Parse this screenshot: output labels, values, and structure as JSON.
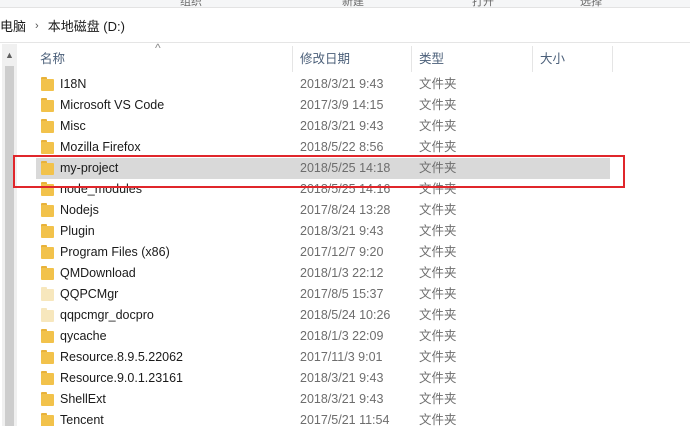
{
  "ribbon": {
    "labels": [
      "组织",
      "新建",
      "打开",
      "选择"
    ]
  },
  "address": {
    "crumbs": [
      "电脑",
      "本地磁盘 (D:)"
    ],
    "separator": "›"
  },
  "columns": {
    "name": "名称",
    "date": "修改日期",
    "type": "类型",
    "size": "大小"
  },
  "sort_indicator": "^",
  "colors": {
    "folder": "#f2c24b",
    "folder_tab": "#e8b23a",
    "folder_light": "#f7e7bd",
    "selected_row": "#d9d9d9",
    "highlight": "#e0262b"
  },
  "rows": [
    {
      "name": "I18N",
      "date": "2018/3/21 9:43",
      "type": "文件夹",
      "icon": "folder-icon",
      "selected": false
    },
    {
      "name": "Microsoft VS Code",
      "date": "2017/3/9 14:15",
      "type": "文件夹",
      "icon": "folder-icon",
      "selected": false
    },
    {
      "name": "Misc",
      "date": "2018/3/21 9:43",
      "type": "文件夹",
      "icon": "folder-icon",
      "selected": false
    },
    {
      "name": "Mozilla Firefox",
      "date": "2018/5/22 8:56",
      "type": "文件夹",
      "icon": "folder-icon",
      "selected": false
    },
    {
      "name": "my-project",
      "date": "2018/5/25 14:18",
      "type": "文件夹",
      "icon": "folder-icon",
      "selected": true
    },
    {
      "name": "node_modules",
      "date": "2018/5/25 14:16",
      "type": "文件夹",
      "icon": "folder-icon",
      "selected": false
    },
    {
      "name": "Nodejs",
      "date": "2017/8/24 13:28",
      "type": "文件夹",
      "icon": "folder-icon",
      "selected": false
    },
    {
      "name": "Plugin",
      "date": "2018/3/21 9:43",
      "type": "文件夹",
      "icon": "folder-icon",
      "selected": false
    },
    {
      "name": "Program Files (x86)",
      "date": "2017/12/7 9:20",
      "type": "文件夹",
      "icon": "folder-icon",
      "selected": false
    },
    {
      "name": "QMDownload",
      "date": "2018/1/3 22:12",
      "type": "文件夹",
      "icon": "folder-icon",
      "selected": false
    },
    {
      "name": "QQPCMgr",
      "date": "2017/8/5 15:37",
      "type": "文件夹",
      "icon": "folder-light-icon",
      "selected": false
    },
    {
      "name": "qqpcmgr_docpro",
      "date": "2018/5/24 10:26",
      "type": "文件夹",
      "icon": "folder-light-icon",
      "selected": false
    },
    {
      "name": "qycache",
      "date": "2018/1/3 22:09",
      "type": "文件夹",
      "icon": "folder-icon",
      "selected": false
    },
    {
      "name": "Resource.8.9.5.22062",
      "date": "2017/11/3 9:01",
      "type": "文件夹",
      "icon": "folder-icon",
      "selected": false
    },
    {
      "name": "Resource.9.0.1.23161",
      "date": "2018/3/21 9:43",
      "type": "文件夹",
      "icon": "folder-icon",
      "selected": false
    },
    {
      "name": "ShellExt",
      "date": "2018/3/21 9:43",
      "type": "文件夹",
      "icon": "folder-icon",
      "selected": false
    },
    {
      "name": "Tencent",
      "date": "2017/5/21 11:54",
      "type": "文件夹",
      "icon": "folder-icon",
      "selected": false
    }
  ]
}
